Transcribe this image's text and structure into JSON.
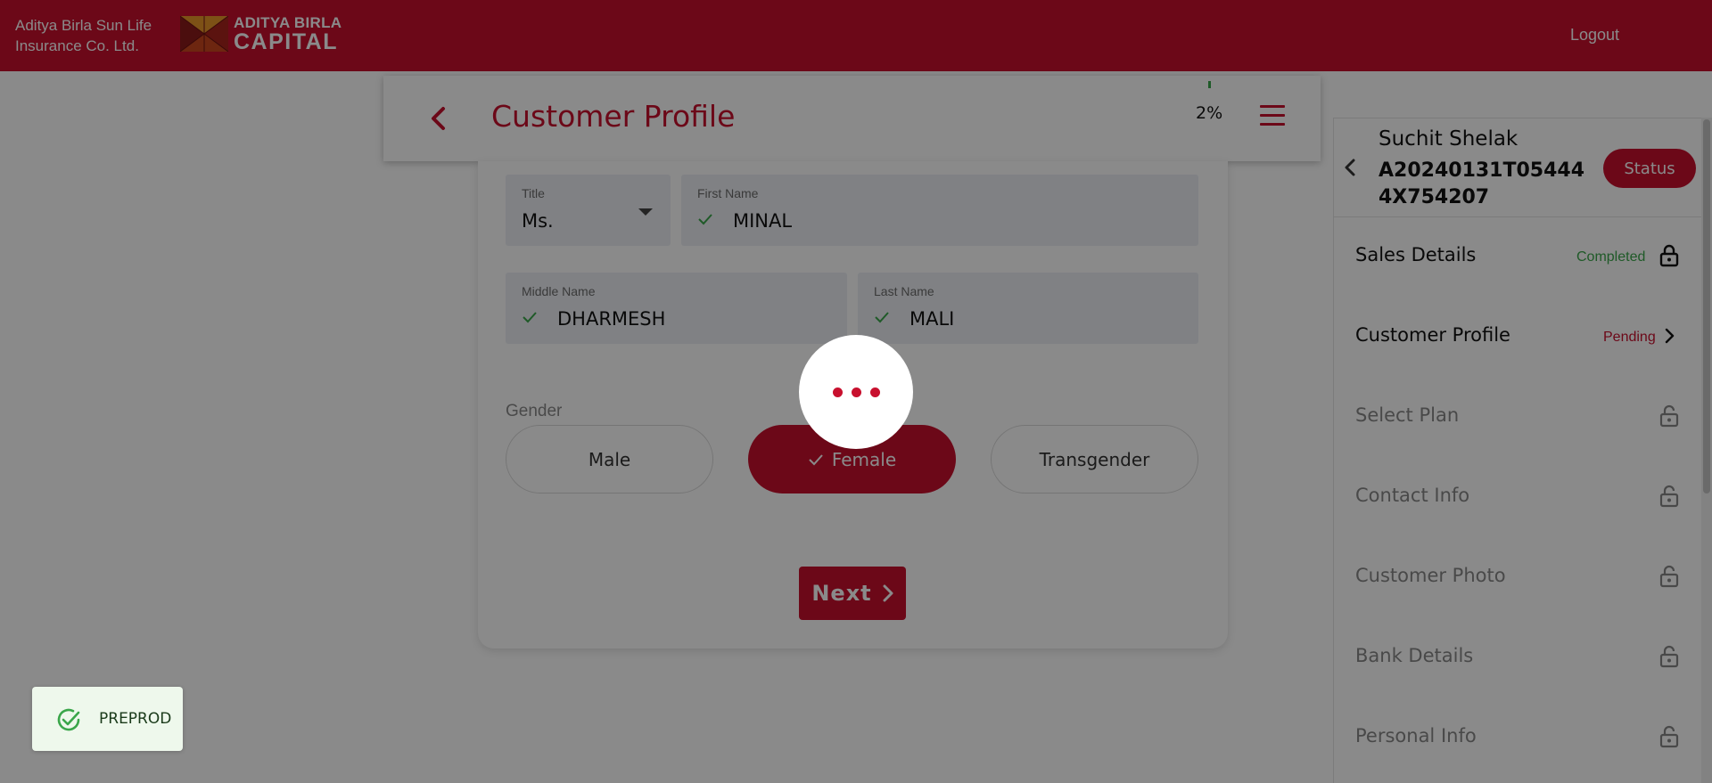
{
  "brand": {
    "company_line1": "Aditya Birla Sun Life",
    "company_line2": "Insurance Co. Ltd.",
    "logo_line1": "ADITYA BIRLA",
    "logo_line2": "CAPITAL"
  },
  "topbar": {
    "logout_label": "Logout"
  },
  "header": {
    "title": "Customer Profile",
    "progress": "2%",
    "progress_value": 0.02,
    "back_icon": "chevron-left-icon",
    "menu_icon": "hamburger-icon"
  },
  "form": {
    "title_field": {
      "label": "Title",
      "value": "Ms."
    },
    "first_name": {
      "label": "First Name",
      "value": "MINAL"
    },
    "middle_name": {
      "label": "Middle Name",
      "value": "DHARMESH"
    },
    "last_name": {
      "label": "Last Name",
      "value": "MALI"
    },
    "gender": {
      "label": "Gender",
      "options": [
        "Male",
        "Female",
        "Transgender"
      ],
      "selected": "Female"
    },
    "next_label": "Next"
  },
  "side_panel": {
    "customer_name": "Suchit Shelak",
    "application_id": "A20240131T054444X754207",
    "status_label": "Status",
    "items": [
      {
        "label": "Sales Details",
        "status": "Completed",
        "icon": "lock-icon"
      },
      {
        "label": "Customer Profile",
        "status": "Pending",
        "icon": "chevron-right-icon"
      },
      {
        "label": "Select Plan",
        "status": "",
        "icon": "lock-icon"
      },
      {
        "label": "Contact Info",
        "status": "",
        "icon": "lock-icon"
      },
      {
        "label": "Customer Photo",
        "status": "",
        "icon": "lock-icon"
      },
      {
        "label": "Bank Details",
        "status": "",
        "icon": "lock-icon"
      },
      {
        "label": "Personal Info",
        "status": "",
        "icon": "lock-icon"
      }
    ]
  },
  "environment": {
    "label": "PREPROD",
    "icon": "check-circle-icon"
  },
  "colors": {
    "brand_red": "#c8102e",
    "success_green": "#3aa64a",
    "pending_text": "#c8102e"
  }
}
